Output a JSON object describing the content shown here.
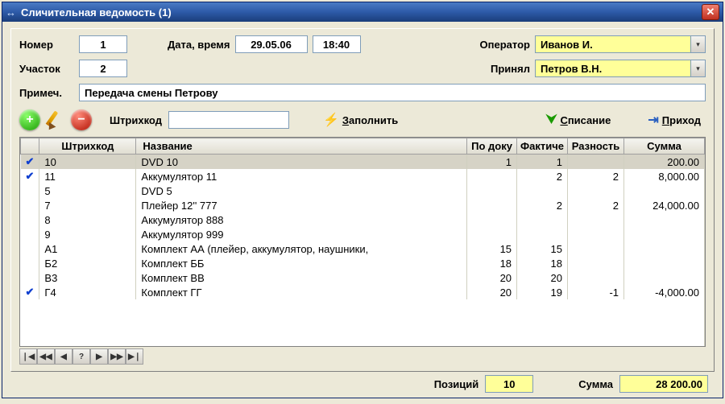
{
  "window": {
    "title": "Сличительная ведомость  (1)"
  },
  "labels": {
    "number": "Номер",
    "section": "Участок",
    "datetime": "Дата, время",
    "operator": "Оператор",
    "accepted": "Принял",
    "note": "Примеч.",
    "barcode": "Штрихкод",
    "fill": "аполнить",
    "fill_u": "З",
    "writeoff": "писание",
    "writeoff_u": "С",
    "income": "риход",
    "income_u": "П"
  },
  "fields": {
    "number": "1",
    "section": "2",
    "date": "29.05.06",
    "time": "18:40",
    "operator": "Иванов И.",
    "accepted": "Петров В.Н.",
    "note": "Передача смены Петрову",
    "barcode": ""
  },
  "columns": {
    "c0": "",
    "c1": "Штрихкод",
    "c2": "Название",
    "c3": "По доку",
    "c4": "Фактиче",
    "c5": "Разность",
    "c6": "Сумма"
  },
  "rows": [
    {
      "chk": true,
      "code": "10",
      "name": "DVD 10",
      "doc": "1",
      "fact": "1",
      "diff": "",
      "sum": "200.00",
      "sel": true
    },
    {
      "chk": true,
      "code": "11",
      "name": "Аккумулятор 11",
      "doc": "",
      "fact": "2",
      "diff": "2",
      "sum": "8,000.00"
    },
    {
      "chk": false,
      "code": "5",
      "name": "DVD 5",
      "doc": "",
      "fact": "",
      "diff": "",
      "sum": ""
    },
    {
      "chk": false,
      "code": "7",
      "name": "Плейер 12'' 777",
      "doc": "",
      "fact": "2",
      "diff": "2",
      "sum": "24,000.00"
    },
    {
      "chk": false,
      "code": "8",
      "name": "Аккумулятор 888",
      "doc": "",
      "fact": "",
      "diff": "",
      "sum": ""
    },
    {
      "chk": false,
      "code": "9",
      "name": "Аккумулятор 999",
      "doc": "",
      "fact": "",
      "diff": "",
      "sum": ""
    },
    {
      "chk": false,
      "code": "А1",
      "name": "Комплект АА (плейер, аккумулятор, наушники,",
      "doc": "15",
      "fact": "15",
      "diff": "",
      "sum": ""
    },
    {
      "chk": false,
      "code": "Б2",
      "name": "Комплект ББ",
      "doc": "18",
      "fact": "18",
      "diff": "",
      "sum": ""
    },
    {
      "chk": false,
      "code": "В3",
      "name": "Комплект ВВ",
      "doc": "20",
      "fact": "20",
      "diff": "",
      "sum": ""
    },
    {
      "chk": true,
      "code": "Г4",
      "name": "Комплект ГГ",
      "doc": "20",
      "fact": "19",
      "diff": "-1",
      "sum": "-4,000.00"
    }
  ],
  "status": {
    "positions_label": "Позиций",
    "positions": "10",
    "sum_label": "Сумма",
    "sum": "28 200.00"
  },
  "nav": [
    "❘◀",
    "◀◀",
    "◀",
    "?",
    "▶",
    "▶▶",
    "▶❘"
  ]
}
